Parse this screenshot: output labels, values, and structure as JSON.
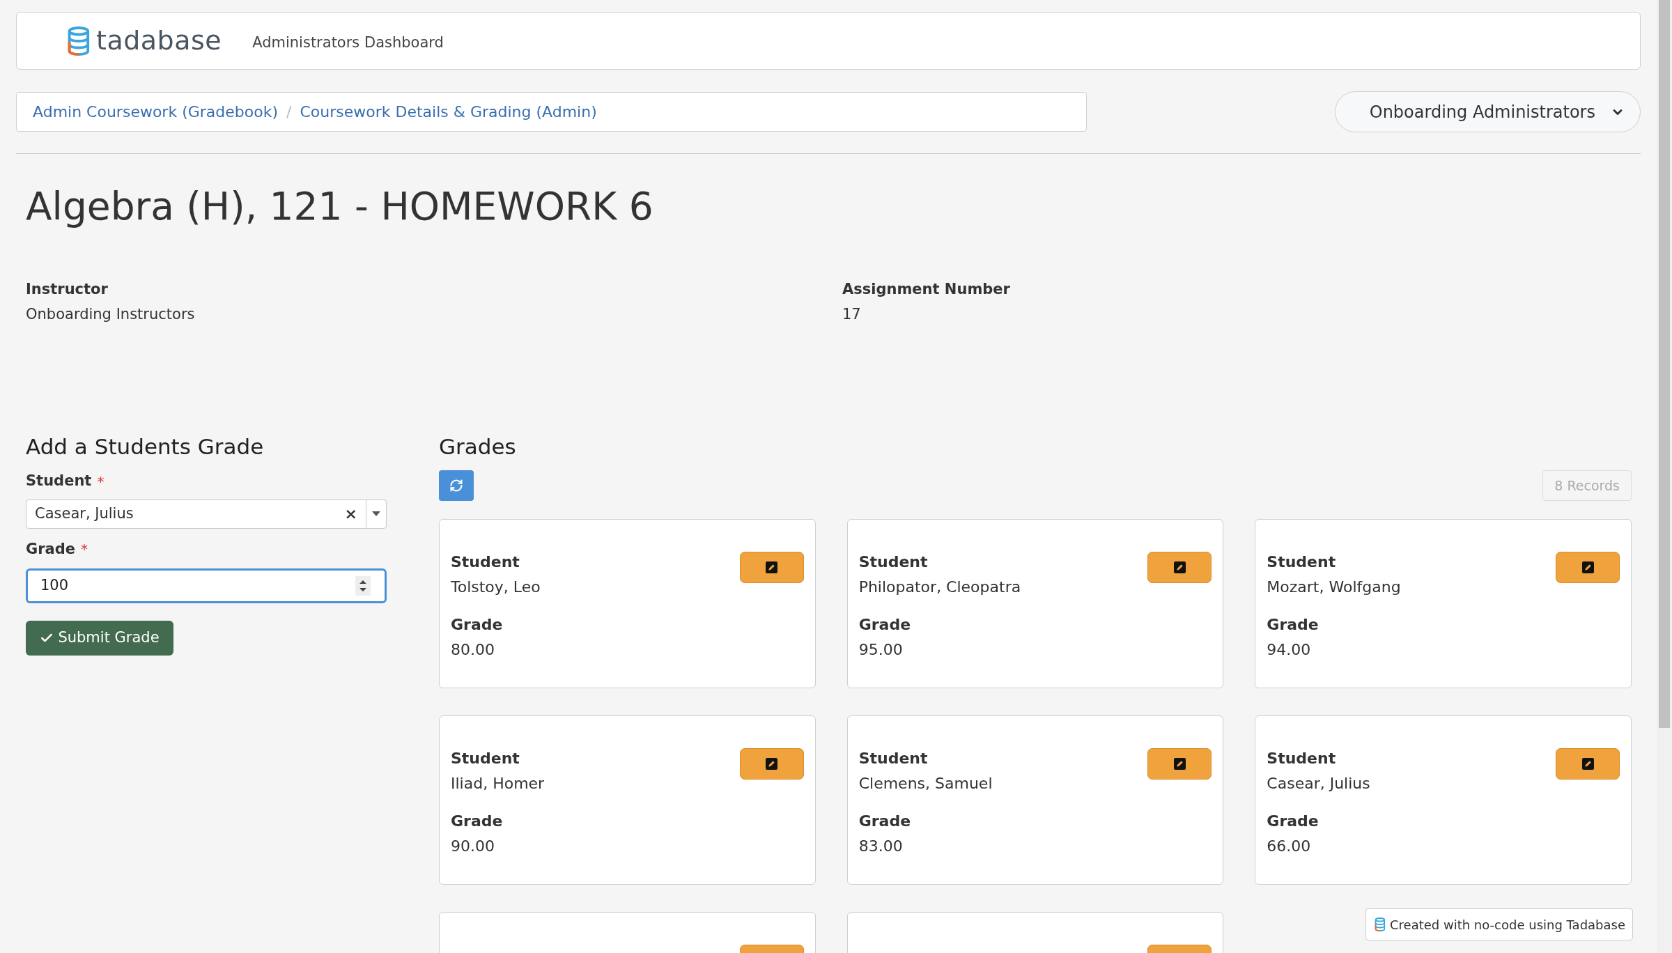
{
  "header": {
    "logo_text": "tadabase",
    "title": "Administrators Dashboard"
  },
  "breadcrumbs": [
    {
      "label": "Admin Coursework (Gradebook)"
    },
    {
      "label": "Coursework Details & Grading (Admin)"
    }
  ],
  "breadcrumb_separator": "/",
  "role_menu": {
    "label": "Onboarding Administrators"
  },
  "page_title": "Algebra (H), 121 - HOMEWORK 6",
  "details": [
    {
      "label": "Instructor",
      "value": "Onboarding Instructors"
    },
    {
      "label": "Assignment Number",
      "value": "17"
    }
  ],
  "form": {
    "heading": "Add a Students Grade",
    "fields": [
      {
        "kind": "select",
        "label": "Student",
        "required": true,
        "value": "Casear, Julius",
        "clear": "×",
        "focused": false
      },
      {
        "kind": "number",
        "label": "Grade",
        "required": true,
        "value": "100",
        "focused": true
      }
    ],
    "required_mark": "*",
    "submit": "Submit Grade"
  },
  "grades": {
    "heading": "Grades",
    "record_count": "8 Records",
    "cards": [
      {
        "kind": "full",
        "student_label": "Student",
        "student": "Tolstoy, Leo",
        "grade_label": "Grade",
        "grade": "80.00"
      },
      {
        "kind": "full",
        "student_label": "Student",
        "student": "Philopator, Cleopatra",
        "grade_label": "Grade",
        "grade": "95.00"
      },
      {
        "kind": "full",
        "student_label": "Student",
        "student": "Mozart, Wolfgang",
        "grade_label": "Grade",
        "grade": "94.00"
      },
      {
        "kind": "full",
        "student_label": "Student",
        "student": "Iliad, Homer",
        "grade_label": "Grade",
        "grade": "90.00"
      },
      {
        "kind": "full",
        "student_label": "Student",
        "student": "Clemens, Samuel",
        "grade_label": "Grade",
        "grade": "83.00"
      },
      {
        "kind": "full",
        "student_label": "Student",
        "student": "Casear, Julius",
        "grade_label": "Grade",
        "grade": "66.00"
      },
      {
        "kind": "partial"
      },
      {
        "kind": "partial"
      }
    ]
  },
  "footer_badge": "Created with no-code using Tadabase"
}
